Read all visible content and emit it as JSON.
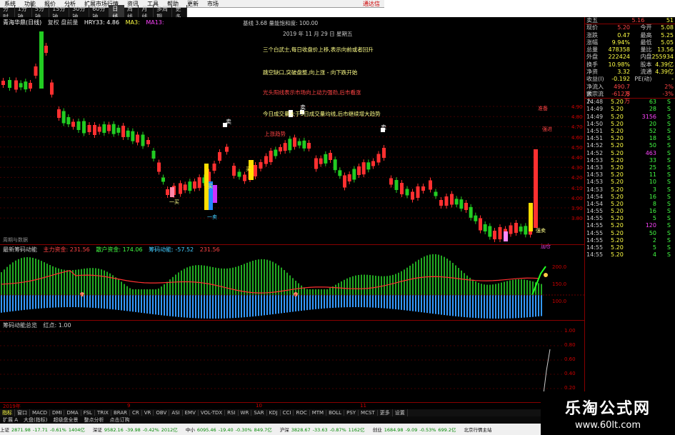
{
  "menubar": {
    "items": [
      "系统",
      "功能",
      "报价",
      "分析",
      "扩展市场行情",
      "资讯",
      "工具",
      "帮助",
      "更新",
      "市场"
    ],
    "brand": "通达信"
  },
  "toolbar": {
    "items": [
      "分时",
      "1分钟",
      "5分钟",
      "15分钟",
      "30分钟",
      "60分钟",
      "日线",
      "周线",
      "月线",
      "多周期",
      "更多"
    ],
    "active_index": 6
  },
  "kline": {
    "header_items": [
      "青海华鼎(日线)",
      "复权 盘前量",
      "HRY33: 4.86",
      "MA3:",
      "MA13:"
    ],
    "annotations": [
      {
        "text": "基线 3.68 量能饱和度: 100.00",
        "color": "#ccc"
      },
      {
        "text": "2019 年 11 月 29 日 星期五",
        "color": "#ccc"
      },
      {
        "text": "三个白武士,每日收盘价上移,表示向前或者回升",
        "color": "#ff8"
      },
      {
        "text": "跳空缺口,突破盘整,向上涨 - 向下跌开始",
        "color": "#ff8"
      },
      {
        "text": "光头阳线表示市场向上动力强劲,后市看涨",
        "color": "#f44"
      },
      {
        "text": "今日成交量大于5日成交量均线,后市继续增大趋势",
        "color": "#ff8"
      },
      {
        "text": "上涨趋势",
        "color": "#f44"
      }
    ],
    "price_labels": [
      "4.90",
      "4.80",
      "4.70",
      "4.60",
      "4.50",
      "4.40",
      "4.30",
      "4.20",
      "4.10",
      "4.00",
      "3.90",
      "3.80"
    ],
    "markers": [
      "卖",
      "卖",
      "卖",
      "买",
      "买",
      "一买",
      "一卖",
      "准备",
      "强进",
      "强卖",
      "加仓",
      "减仓",
      "卖出",
      "持股"
    ],
    "corner_label": "周期与数据"
  },
  "macd": {
    "title_items": [
      "最新筹码动能",
      "主力资金: 231.56",
      "散户资金: 174.06",
      "筹码动能: -57.52",
      "231.56"
    ],
    "labels": [
      "200.0",
      "150.0",
      "100.0"
    ]
  },
  "vol": {
    "title_items": [
      "筹码动能总览",
      "红点: 1.00"
    ],
    "labels": [
      "1.00",
      "0.80",
      "0.60",
      "0.40",
      "0.20"
    ]
  },
  "quote": {
    "header": {
      "name": "卖五",
      "price": "5.16",
      "vol": "51"
    },
    "rows": [
      {
        "a": "现价",
        "b": "5.20",
        "c": "今开",
        "d": "5.08"
      },
      {
        "a": "涨跌",
        "b": "0.47",
        "c": "最高",
        "d": "5.25"
      },
      {
        "a": "涨幅",
        "b": "9.94%",
        "c": "最低",
        "d": "5.05"
      },
      {
        "a": "总量",
        "b": "478358",
        "c": "量比",
        "d": "13.56"
      },
      {
        "a": "外盘",
        "b": "222424",
        "c": "内盘",
        "d": "255934"
      },
      {
        "a": "换手",
        "b": "10.98%",
        "c": "股本",
        "d": "4.39亿"
      },
      {
        "a": "净资",
        "b": "3.32",
        "c": "流通",
        "d": "4.39亿"
      },
      {
        "a": "收益(I)",
        "b": "-0.192",
        "c": "PE(动)",
        "d": "-"
      },
      {
        "a": "净流入额",
        "b": "490.7万",
        "c": "",
        "d": "2%"
      },
      {
        "a": "大宗流入",
        "b": "-612.8万",
        "c": "",
        "d": "-3%"
      }
    ],
    "ticks": [
      {
        "t": "14:48",
        "p": "5.20",
        "v": "63",
        "s": "S"
      },
      {
        "t": "14:49",
        "p": "5.20",
        "v": "28",
        "s": "S"
      },
      {
        "t": "14:49",
        "p": "5.20",
        "v": "3156",
        "s": "S"
      },
      {
        "t": "14:50",
        "p": "5.20",
        "v": "20",
        "s": "S"
      },
      {
        "t": "14:51",
        "p": "5.20",
        "v": "52",
        "s": "S"
      },
      {
        "t": "14:51",
        "p": "5.20",
        "v": "18",
        "s": "S"
      },
      {
        "t": "14:52",
        "p": "5.20",
        "v": "50",
        "s": "S"
      },
      {
        "t": "14:52",
        "p": "5.20",
        "v": "463",
        "s": "S"
      },
      {
        "t": "14:53",
        "p": "5.20",
        "v": "33",
        "s": "S"
      },
      {
        "t": "14:53",
        "p": "5.20",
        "v": "25",
        "s": "S"
      },
      {
        "t": "14:53",
        "p": "5.20",
        "v": "11",
        "s": "S"
      },
      {
        "t": "14:53",
        "p": "5.20",
        "v": "10",
        "s": "S"
      },
      {
        "t": "14:53",
        "p": "5.20",
        "v": "3",
        "s": "S"
      },
      {
        "t": "14:54",
        "p": "5.20",
        "v": "16",
        "s": "S"
      },
      {
        "t": "14:54",
        "p": "5.20",
        "v": "8",
        "s": "S"
      },
      {
        "t": "14:55",
        "p": "5.20",
        "v": "16",
        "s": "S"
      },
      {
        "t": "14:55",
        "p": "5.20",
        "v": "5",
        "s": "S"
      },
      {
        "t": "14:55",
        "p": "5.20",
        "v": "120",
        "s": "S"
      },
      {
        "t": "14:55",
        "p": "5.20",
        "v": "50",
        "s": "S"
      },
      {
        "t": "14:55",
        "p": "5.20",
        "v": "2",
        "s": "S"
      },
      {
        "t": "14:55",
        "p": "5.20",
        "v": "5",
        "s": "S"
      },
      {
        "t": "14:55",
        "p": "5.20",
        "v": "4",
        "s": "S"
      }
    ]
  },
  "date_axis": [
    "2019年",
    "9",
    "10",
    "11"
  ],
  "indicator_tabs": [
    "指标",
    "窗口",
    "MACD",
    "DMI",
    "DMA",
    "FSL",
    "TRIX",
    "BRAR",
    "CR",
    "VR",
    "OBV",
    "ASI",
    "EMV",
    "VOL-TDX",
    "RSI",
    "WR",
    "SAR",
    "KDJ",
    "CCI",
    "ROC",
    "MTM",
    "BOLL",
    "PSY",
    "MCST",
    "更多",
    "设置"
  ],
  "func_bar": [
    "扩展 A",
    "大盘(指标)",
    "超级盘全景",
    "整点分析",
    "点击订购"
  ],
  "status": [
    {
      "name": "上证",
      "val": "2871.98",
      "chg": "-17.71",
      "pct": "-0.61%",
      "amt": "1404亿",
      "dir": "dn"
    },
    {
      "name": "深证",
      "val": "9582.16",
      "chg": "-39.98",
      "pct": "-0.42%",
      "amt": "2012亿",
      "dir": "dn"
    },
    {
      "name": "中小",
      "val": "6095.46",
      "chg": "-19.40",
      "pct": "-0.30%",
      "amt": "849.7亿",
      "dir": "dn"
    },
    {
      "name": "沪深",
      "val": "3828.67",
      "chg": "-33.63",
      "pct": "-0.87%",
      "amt": "1162亿",
      "dir": "dn"
    },
    {
      "name": "创业",
      "val": "1684.98",
      "chg": "-9.09",
      "pct": "-0.53%",
      "amt": "699.2亿",
      "dir": "dn"
    },
    {
      "name": "北京行情主站",
      "val": "",
      "chg": "",
      "pct": "",
      "amt": "",
      "dir": "up"
    }
  ],
  "watermark": {
    "line1": "乐淘公式网",
    "line2": "www.60lt.com"
  },
  "colors": {
    "up": "#ff3030",
    "down": "#22cc22",
    "accent": "#ffff40",
    "grid": "#800000"
  }
}
